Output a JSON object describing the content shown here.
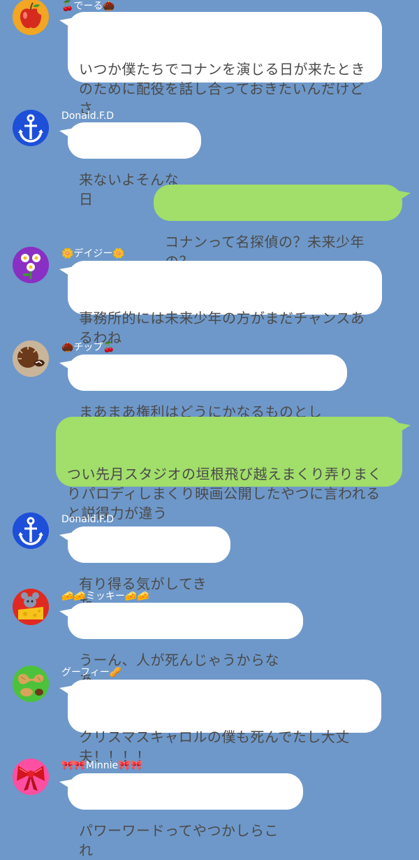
{
  "colors": {
    "background": "#6e98c9",
    "incoming_bubble": "#ffffff",
    "outgoing_bubble": "#a1de6a",
    "sender_name": "#ffffff",
    "message_text": "#4a4a4a"
  },
  "messages": [
    {
      "type": "incoming",
      "sender": "🍒でーる🌰",
      "avatar_icon": "apple-icon",
      "text": "いつか僕たちでコナンを演じる日が来たとき\nのために配役を話し合っておきたいんだけど\nさ"
    },
    {
      "type": "incoming",
      "sender": "Donald.F.D",
      "avatar_icon": "anchor-icon",
      "text": "来ないよそんな日"
    },
    {
      "type": "outgoing",
      "text": "コナンって名探偵の？未来少年の？"
    },
    {
      "type": "incoming",
      "sender": "🌼デイジー🌼",
      "avatar_icon": "daisy-icon",
      "text": "事務所的には未来少年の方がまだチャンスあ\nるわね"
    },
    {
      "type": "incoming",
      "sender": "🌰チップ🍒",
      "avatar_icon": "chestnut-icon",
      "text": "まあまあ権利はどうにかなるものとして"
    },
    {
      "type": "outgoing",
      "text": "つい先月スタジオの垣根飛び越えまくり弄りまく\nりパロディしまくり映画公開したやつに言われる\nと説得力が違う"
    },
    {
      "type": "incoming",
      "sender": "Donald.F.D",
      "avatar_icon": "anchor-icon",
      "text": "有り得る気がしてきた"
    },
    {
      "type": "incoming",
      "sender": "🧀🧀ミッキー🧀🧀",
      "avatar_icon": "mouse-cheese-icon",
      "text": "うーん、人が死んじゃうからなあ"
    },
    {
      "type": "incoming",
      "sender": "グーフィー🥜",
      "avatar_icon": "peanut-icon",
      "text": "クリスマスキャロルの僕も死んでたし大丈\n夫！！！！"
    },
    {
      "type": "incoming",
      "sender": "🎀🎀Minnie🎀🎀",
      "avatar_icon": "ribbon-icon",
      "text": "パワーワードってやつかしらこれ"
    }
  ]
}
